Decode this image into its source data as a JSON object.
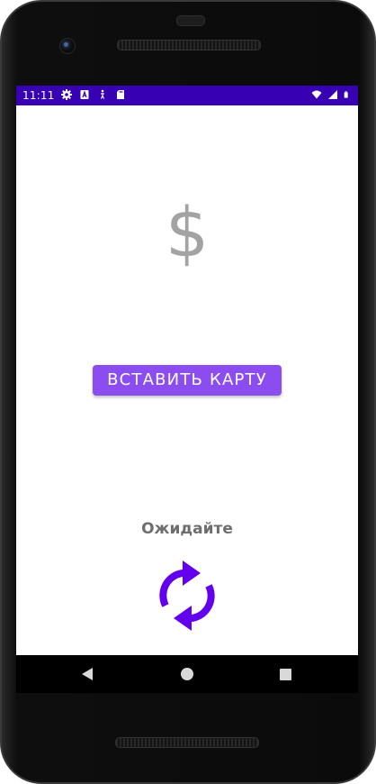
{
  "status_bar": {
    "time": "11:11",
    "background": "#3700b3",
    "left_icons": [
      "settings-icon",
      "a-badge-icon",
      "accessibility-icon",
      "sd-card-icon"
    ],
    "right_icons": [
      "wifi-icon",
      "cell-signal-icon",
      "battery-icon"
    ]
  },
  "main": {
    "currency_symbol": "$",
    "insert_card_button": "ВСТАВИТЬ КАРТУ",
    "status_text": "Ожидайте",
    "refresh_icon": "sync-icon",
    "colors": {
      "button": "#8c4df0",
      "icon": "#6200ee",
      "symbol": "#a3a3a3"
    }
  },
  "nav_bar": {
    "buttons": [
      "back-icon",
      "home-icon",
      "recent-apps-icon"
    ]
  }
}
